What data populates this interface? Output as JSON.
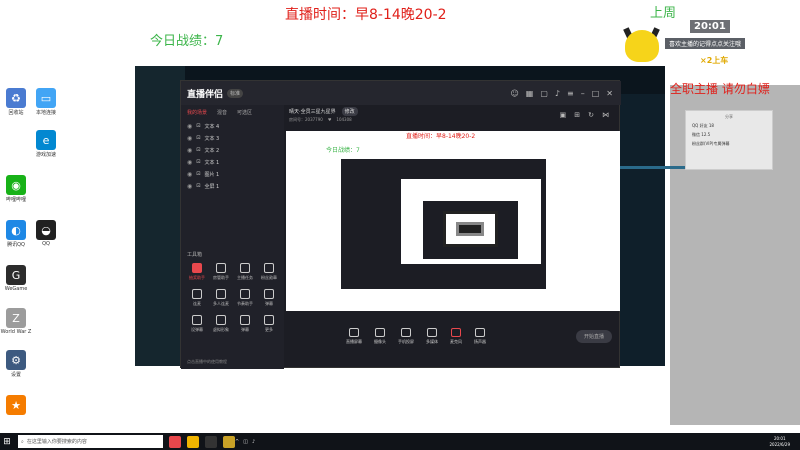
{
  "overlays": {
    "live_time": "直播时间：早8-14晚20-2",
    "today_score": "今日战绩：7",
    "last_week_rank": "上周",
    "all_dance": "全职主播 请勿白嫖",
    "follow_tip": "喜欢主播的记得点点关注哦",
    "bus_text": "×2上车"
  },
  "system": {
    "time": "20:01",
    "weather": "27/33°",
    "taskbar_search": "在这里输入你要搜索的内容",
    "taskbar_time": "20:01",
    "taskbar_date": "2022/6/29"
  },
  "desktop": {
    "icons": [
      {
        "label": "回收站"
      },
      {
        "label": "哔哩哔哩"
      },
      {
        "label": "腾讯QQ"
      },
      {
        "label": "WeGame"
      },
      {
        "label": "World War Z"
      },
      {
        "label": "设置"
      }
    ],
    "icons_col2": [
      {
        "label": "本地连接"
      },
      {
        "label": "游戏加速"
      },
      {
        "label": "QQ"
      }
    ]
  },
  "app": {
    "logo": "直播伴侣",
    "logo_badge": "标准",
    "tabs": [
      "我的场景",
      "混音",
      "可选区"
    ],
    "layers": [
      "文本 4",
      "文本 3",
      "文本 2",
      "文本 1",
      "图片 1",
      "全屏 1"
    ],
    "tools_title": "工具箱",
    "tools": [
      {
        "label": "抽奖助手"
      },
      {
        "label": "房管助手"
      },
      {
        "label": "主播任务"
      },
      {
        "label": "粉丝勋章"
      },
      {
        "label": "连麦"
      },
      {
        "label": "多人连麦"
      },
      {
        "label": "节奏助手"
      },
      {
        "label": "弹幕"
      },
      {
        "label": "设弹幕"
      },
      {
        "label": "虚拟形象"
      },
      {
        "label": "弹幕"
      },
      {
        "label": "更多"
      }
    ],
    "side_footer": "点击直播中的使用教程",
    "stream_title": "晴天·全员三星九星界",
    "stream_badge": "修改",
    "stream_room": "房间号：2037790",
    "stream_fans": "104308",
    "bottom_items": [
      "直播屏幕",
      "摄像头",
      "手机投屏",
      "多媒体",
      "麦克风",
      "扬声器"
    ],
    "live_button": "开始直播"
  },
  "preview": {
    "live_time": "直播时间：早8-14晚20-2",
    "score": "今日战绩：7"
  },
  "right_panel": {
    "title": "分享",
    "lines": [
      "QQ 好友 18",
      "微信 12.5",
      "粉丝群(VIP)专属弹幕"
    ]
  }
}
